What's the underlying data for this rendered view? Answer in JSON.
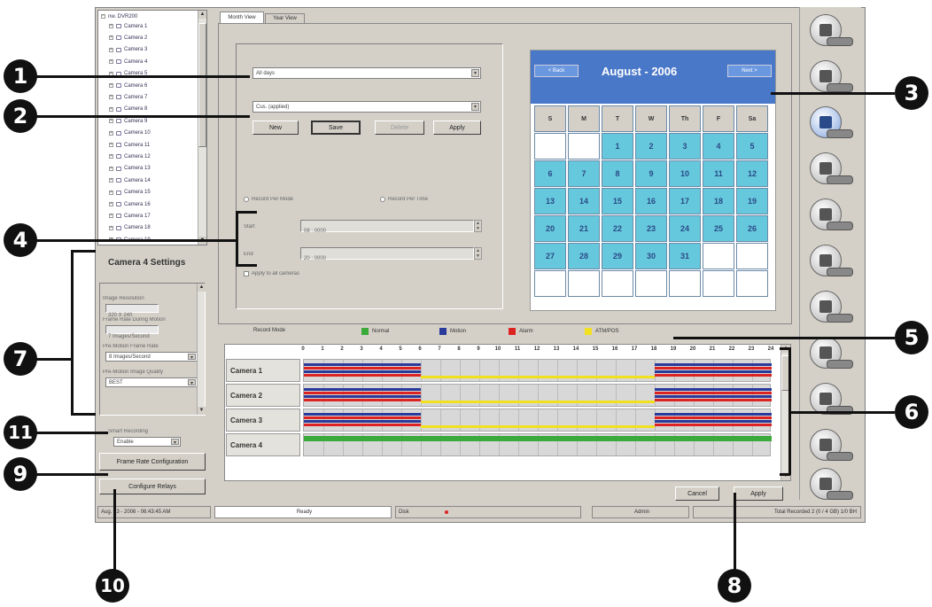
{
  "tree": {
    "root_label": "nw. DVR200",
    "items": [
      "Camera 1",
      "Camera 2",
      "Camera 3",
      "Camera 4",
      "Camera 5",
      "Camera 6",
      "Camera 7",
      "Camera 8",
      "Camera 9",
      "Camera 10",
      "Camera 11",
      "Camera 12",
      "Camera 13",
      "Camera 14",
      "Camera 15",
      "Camera 16",
      "Camera 17",
      "Camera 18",
      "Camera 19"
    ]
  },
  "settings": {
    "title": "Camera 4 Settings",
    "image_resolution_label": "Image Resolution",
    "image_resolution_value": "320 X 240",
    "frame_rate_label": "Frame Rate During Motion",
    "frame_rate_value": "7 Images/Second",
    "pre_motion_rate_label": "Pre-Motion Frame Rate",
    "pre_motion_rate_value": "8 Images/Second",
    "pre_motion_quality_label": "Pre-Motion Image Quality",
    "pre_motion_quality_value": "BEST",
    "smart_recording_label": "Smart Recording",
    "smart_recording_value": "Enable",
    "frame_rate_config_button": "Frame Rate Configuration",
    "configure_relays_button": "Configure Relays"
  },
  "tabs": [
    "Month View",
    "Year View"
  ],
  "schedule_form": {
    "days_value": "All days",
    "preset_value": "Cus. (applied)",
    "new_button": "New",
    "save_button": "Save",
    "delete_button": "Delete",
    "apply_button": "Apply",
    "radio_by_mode": "Record Per Mode",
    "radio_by_time": "Record Per Time",
    "start_label": "Start",
    "start_value": "08 : 0000",
    "end_label": "End",
    "end_value": "20 : 0000",
    "apply_all_label": "Apply to all cameras"
  },
  "calendar": {
    "back_button": "< Back",
    "next_button": "Next >",
    "month_title": "August - 2006",
    "weekdays": [
      "S",
      "M",
      "T",
      "W",
      "Th",
      "F",
      "Sa"
    ],
    "weeks": [
      [
        "",
        "",
        "1",
        "2",
        "3",
        "4",
        "5"
      ],
      [
        "6",
        "7",
        "8",
        "9",
        "10",
        "11",
        "12"
      ],
      [
        "13",
        "14",
        "15",
        "16",
        "17",
        "18",
        "19"
      ],
      [
        "20",
        "21",
        "22",
        "23",
        "24",
        "25",
        "26"
      ],
      [
        "27",
        "28",
        "29",
        "30",
        "31",
        "",
        ""
      ],
      [
        "",
        "",
        "",
        "",
        "",
        "",
        ""
      ]
    ]
  },
  "legend": {
    "title": "Record Mode",
    "items": [
      {
        "label": "Normal",
        "color": "#3aaa3a"
      },
      {
        "label": "Motion",
        "color": "#2a3a9a"
      },
      {
        "label": "Alarm",
        "color": "#dd2222"
      },
      {
        "label": "ATM/POS",
        "color": "#f0e020"
      }
    ]
  },
  "schedule": {
    "hours": [
      "0",
      "1",
      "2",
      "3",
      "4",
      "5",
      "6",
      "7",
      "8",
      "9",
      "10",
      "11",
      "12",
      "13",
      "14",
      "15",
      "16",
      "17",
      "18",
      "19",
      "20",
      "21",
      "22",
      "23",
      "24"
    ],
    "cameras": [
      "Camera 1",
      "Camera 2",
      "Camera 3",
      "Camera 4"
    ]
  },
  "footer": {
    "cancel_button": "Cancel",
    "apply_button": "Apply"
  },
  "status_bar": {
    "datetime": "Aug. 13 - 2006 - 06:43:45 AM",
    "state": "Ready",
    "disk": "Disk",
    "user": "Admin",
    "total": "Total Recorded 2 (0 / 4 GB) 1/0 BH"
  },
  "callouts": [
    "1",
    "2",
    "3",
    "4",
    "5",
    "6",
    "7",
    "8",
    "9",
    "10",
    "11"
  ]
}
